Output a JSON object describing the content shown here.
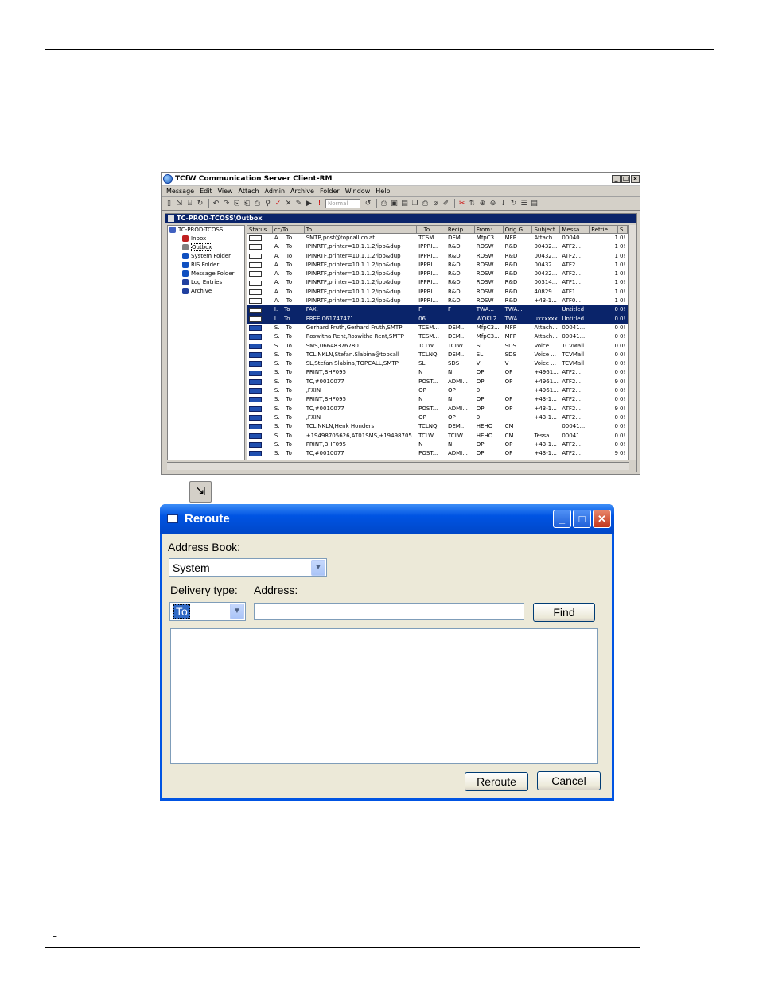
{
  "client": {
    "title": "TCfW Communication Server Client-RM",
    "menu": [
      "Message",
      "Edit",
      "View",
      "Attach",
      "Admin",
      "Archive",
      "Folder",
      "Window",
      "Help"
    ],
    "priority_placeholder": "Normal",
    "doc_title": "TC-PROD-TCOSS\\Outbox",
    "tree": [
      {
        "label": "TC-PROD-TCOSS",
        "icon": "server-icon",
        "color": "#4060c0"
      },
      {
        "label": "Inbox",
        "icon": "inbox-icon",
        "color": "#c02020"
      },
      {
        "label": "Outbox",
        "icon": "outbox-icon",
        "color": "#808080"
      },
      {
        "label": "System Folder",
        "icon": "globe-icon",
        "color": "#1050c0"
      },
      {
        "label": "RIS Folder",
        "icon": "ris-icon",
        "color": "#1050c0"
      },
      {
        "label": "Message Folder",
        "icon": "message-folder-icon",
        "color": "#1050c0"
      },
      {
        "label": "Log Entries",
        "icon": "log-icon",
        "color": "#2040a0"
      },
      {
        "label": "Archive",
        "icon": "archive-icon",
        "color": "#2040a0"
      }
    ],
    "columns": [
      "Status",
      "cc/To",
      "To",
      "...To",
      "Recip...",
      "From:",
      "Orig G...",
      "Subject",
      "Messa...",
      "Retrie...",
      "S..."
    ],
    "rows": [
      {
        "st": "A.",
        "cc": "To",
        "to": "SMTP,post@topcall.co.at",
        "t2": "TCSM...",
        "rc": "DEM...",
        "fr": "MfpC3...",
        "og": "MFP",
        "sb": "Attach...",
        "ms": "00040...",
        "rt": "1",
        "s": "0!",
        "sel": false,
        "blue": false
      },
      {
        "st": "A.",
        "cc": "To",
        "to": "IPINRTF,printer=10.1.1.2/ipp&dup",
        "t2": "IPPRI...",
        "rc": "R&D",
        "fr": "ROSW",
        "og": "R&D",
        "sb": "00432...",
        "ms": "ATF2...",
        "rt": "1",
        "s": "0!",
        "sel": false,
        "blue": false
      },
      {
        "st": "A.",
        "cc": "To",
        "to": "IPINRTF,printer=10.1.1.2/ipp&dup",
        "t2": "IPPRI...",
        "rc": "R&D",
        "fr": "ROSW",
        "og": "R&D",
        "sb": "00432...",
        "ms": "ATF2...",
        "rt": "1",
        "s": "0!",
        "sel": false,
        "blue": false
      },
      {
        "st": "A.",
        "cc": "To",
        "to": "IPINRTF,printer=10.1.1.2/ipp&dup",
        "t2": "IPPRI...",
        "rc": "R&D",
        "fr": "ROSW",
        "og": "R&D",
        "sb": "00432...",
        "ms": "ATF2...",
        "rt": "1",
        "s": "0!",
        "sel": false,
        "blue": false
      },
      {
        "st": "A.",
        "cc": "To",
        "to": "IPINRTF,printer=10.1.1.2/ipp&dup",
        "t2": "IPPRI...",
        "rc": "R&D",
        "fr": "ROSW",
        "og": "R&D",
        "sb": "00432...",
        "ms": "ATF2...",
        "rt": "1",
        "s": "0!",
        "sel": false,
        "blue": false
      },
      {
        "st": "A.",
        "cc": "To",
        "to": "IPINRTF,printer=10.1.1.2/ipp&dup",
        "t2": "IPPRI...",
        "rc": "R&D",
        "fr": "ROSW",
        "og": "R&D",
        "sb": "00314...",
        "ms": "ATF1...",
        "rt": "1",
        "s": "0!",
        "sel": false,
        "blue": false
      },
      {
        "st": "A.",
        "cc": "To",
        "to": "IPINRTF,printer=10.1.1.2/ipp&dup",
        "t2": "IPPRI...",
        "rc": "R&D",
        "fr": "ROSW",
        "og": "R&D",
        "sb": "40829...",
        "ms": "ATF1...",
        "rt": "1",
        "s": "0!",
        "sel": false,
        "blue": false
      },
      {
        "st": "A.",
        "cc": "To",
        "to": "IPINRTF,printer=10.1.1.2/ipp&dup",
        "t2": "IPPRI...",
        "rc": "R&D",
        "fr": "ROSW",
        "og": "R&D",
        "sb": "+43-1...",
        "ms": "ATF0...",
        "rt": "1",
        "s": "0!",
        "sel": false,
        "blue": false
      },
      {
        "st": "I.",
        "cc": "To",
        "to": "FAX,",
        "t2": "F",
        "rc": "F",
        "fr": "TWA...",
        "og": "TWA...",
        "sb": "",
        "ms": "Untitled",
        "rt": "0",
        "s": "0!",
        "sel": true,
        "blue": false
      },
      {
        "st": "I.",
        "cc": "To",
        "to": "FREE,061747471",
        "t2": "06",
        "rc": "",
        "fr": "WOKL2",
        "og": "TWA...",
        "sb": "uxxxxxx",
        "ms": "Untitled",
        "rt": "0",
        "s": "0!",
        "sel": true,
        "blue": false
      },
      {
        "st": "S.",
        "cc": "To",
        "to": "Gerhard Fruth,Gerhard Fruth,SMTP",
        "t2": "TCSM...",
        "rc": "DEM...",
        "fr": "MfpC3...",
        "og": "MFP",
        "sb": "Attach...",
        "ms": "00041...",
        "rt": "0",
        "s": "0!",
        "sel": false,
        "blue": true
      },
      {
        "st": "S.",
        "cc": "To",
        "to": "Roswitha Rent,Roswitha Rent,SMTP",
        "t2": "TCSM...",
        "rc": "DEM...",
        "fr": "MfpC3...",
        "og": "MFP",
        "sb": "Attach...",
        "ms": "00041...",
        "rt": "0",
        "s": "0!",
        "sel": false,
        "blue": true
      },
      {
        "st": "S.",
        "cc": "To",
        "to": "SMS,06648376780",
        "t2": "TCLW...",
        "rc": "TCLW...",
        "fr": "SL",
        "og": "SDS",
        "sb": "Voice ...",
        "ms": "TCVMail",
        "rt": "0",
        "s": "0!",
        "sel": false,
        "blue": true
      },
      {
        "st": "S.",
        "cc": "To",
        "to": "TCLINKLN,Stefan.Slabina@topcall",
        "t2": "TCLNQI",
        "rc": "DEM...",
        "fr": "SL",
        "og": "SDS",
        "sb": "Voice ...",
        "ms": "TCVMail",
        "rt": "0",
        "s": "0!",
        "sel": false,
        "blue": true
      },
      {
        "st": "S.",
        "cc": "To",
        "to": "SL,Stefan Slabina,TOPCALL,SMTP",
        "t2": "SL",
        "rc": "SDS",
        "fr": "V",
        "og": "V",
        "sb": "Voice ...",
        "ms": "TCVMail",
        "rt": "0",
        "s": "0!",
        "sel": false,
        "blue": true
      },
      {
        "st": "S.",
        "cc": "To",
        "to": "PRINT,BHF095",
        "t2": "N",
        "rc": "N",
        "fr": "OP",
        "og": "OP",
        "sb": "+4961...",
        "ms": "ATF2...",
        "rt": "0",
        "s": "0!",
        "sel": false,
        "blue": true
      },
      {
        "st": "S.",
        "cc": "To",
        "to": "TC,#0010077",
        "t2": "POST...",
        "rc": "ADMI...",
        "fr": "OP",
        "og": "OP",
        "sb": "+4961...",
        "ms": "ATF2...",
        "rt": "9",
        "s": "0!",
        "sel": false,
        "blue": true
      },
      {
        "st": "S.",
        "cc": "To",
        "to": ",FXIN",
        "t2": "OP",
        "rc": "OP",
        "fr": "0",
        "og": "",
        "sb": "+4961...",
        "ms": "ATF2...",
        "rt": "0",
        "s": "0!",
        "sel": false,
        "blue": true
      },
      {
        "st": "S.",
        "cc": "To",
        "to": "PRINT,BHF095",
        "t2": "N",
        "rc": "N",
        "fr": "OP",
        "og": "OP",
        "sb": "+43-1...",
        "ms": "ATF2...",
        "rt": "0",
        "s": "0!",
        "sel": false,
        "blue": true
      },
      {
        "st": "S.",
        "cc": "To",
        "to": "TC,#0010077",
        "t2": "POST...",
        "rc": "ADMI...",
        "fr": "OP",
        "og": "OP",
        "sb": "+43-1...",
        "ms": "ATF2...",
        "rt": "9",
        "s": "0!",
        "sel": false,
        "blue": true
      },
      {
        "st": "S.",
        "cc": "To",
        "to": ",FXIN",
        "t2": "OP",
        "rc": "OP",
        "fr": "0",
        "og": "",
        "sb": "+43-1...",
        "ms": "ATF2...",
        "rt": "0",
        "s": "0!",
        "sel": false,
        "blue": true
      },
      {
        "st": "S.",
        "cc": "To",
        "to": "TCLINKLN,Henk Honders",
        "t2": "TCLNQI",
        "rc": "DEM...",
        "fr": "HEHO",
        "og": "CM",
        "sb": "",
        "ms": "00041...",
        "rt": "0",
        "s": "0!",
        "sel": false,
        "blue": true
      },
      {
        "st": "S.",
        "cc": "To",
        "to": "+19498705626,AT01SMS,+19498705...",
        "t2": "TCLW...",
        "rc": "TCLW...",
        "fr": "HEHO",
        "og": "CM",
        "sb": "Tessa...",
        "ms": "00041...",
        "rt": "0",
        "s": "0!",
        "sel": false,
        "blue": true
      },
      {
        "st": "S.",
        "cc": "To",
        "to": "PRINT,BHF095",
        "t2": "N",
        "rc": "N",
        "fr": "OP",
        "og": "OP",
        "sb": "+43-1...",
        "ms": "ATF2...",
        "rt": "0",
        "s": "0!",
        "sel": false,
        "blue": true
      },
      {
        "st": "S.",
        "cc": "To",
        "to": "TC,#0010077",
        "t2": "POST...",
        "rc": "ADMI...",
        "fr": "OP",
        "og": "OP",
        "sb": "+43-1...",
        "ms": "ATF2...",
        "rt": "9",
        "s": "0!",
        "sel": false,
        "blue": true
      }
    ]
  },
  "dialog": {
    "title": "Reroute",
    "address_book_label": "Address Book:",
    "address_book_value": "System",
    "delivery_type_label": "Delivery type:",
    "delivery_type_value": "To",
    "address_label": "Address:",
    "address_value": "",
    "find_label": "Find",
    "reroute_label": "Reroute",
    "cancel_label": "Cancel"
  },
  "footer": {
    "mark": "–"
  }
}
